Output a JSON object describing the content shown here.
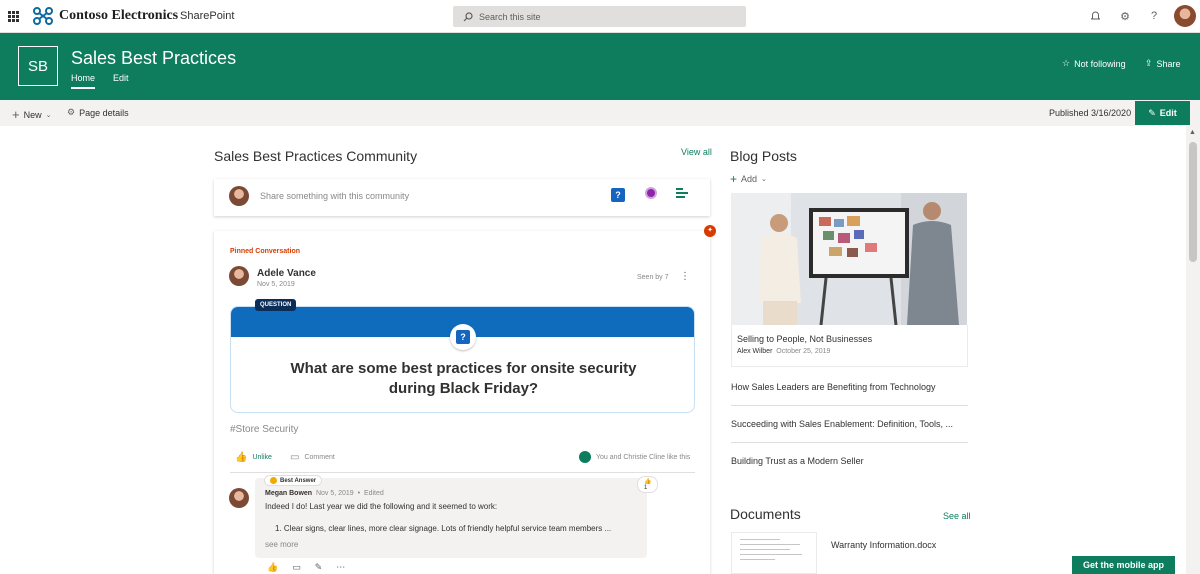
{
  "suite": {
    "brand_name": "Contoso Electronics",
    "app_name": "SharePoint",
    "search_placeholder": "Search this site"
  },
  "site": {
    "logo_text": "SB",
    "title": "Sales Best Practices",
    "nav": [
      "Home",
      "Edit"
    ],
    "follow_label": "Not following",
    "share_label": "Share",
    "accent_color": "#0d7d5e"
  },
  "command_bar": {
    "new_label": "New",
    "page_details_label": "Page details",
    "published": "Published 3/16/2020",
    "edit_label": "Edit"
  },
  "community": {
    "title": "Sales Best Practices Community",
    "view_all": "View all",
    "share_placeholder": "Share something with this community",
    "post": {
      "pinned_label": "Pinned Conversation",
      "author": "Adele Vance",
      "date": "Nov 5, 2019",
      "seen": "Seen by 7",
      "question_badge": "QUESTION",
      "question": "What are some best practices for onsite security during Black Friday?",
      "topic": "#Store Security",
      "unlike_label": "Unlike",
      "comment_label": "Comment",
      "likes_summary": "You and Christie Cline like this",
      "best_answer": {
        "badge": "Best Answer",
        "author": "Megan Bowen",
        "date": "Nov 5, 2019",
        "edited": "Edited",
        "like_count": "1",
        "line1": "Indeed I do! Last year we did the following and it seemed to work:",
        "line2": "1.   Clear signs, clear lines, more clear signage. Lots of friendly helpful service team members ...",
        "see_more": "see more"
      }
    }
  },
  "blog": {
    "title": "Blog Posts",
    "add_label": "Add",
    "featured": {
      "title": "Selling to People, Not Businesses",
      "author": "Alex Wilber",
      "date": "October 25, 2019"
    },
    "items": [
      "How Sales Leaders are Benefiting from Technology",
      "Succeeding with Sales Enablement: Definition, Tools, ...",
      "Building Trust as a Modern Seller"
    ]
  },
  "documents": {
    "title": "Documents",
    "see_all": "See all",
    "items": [
      "Warranty Information.docx"
    ]
  },
  "mobile_app_label": "Get the mobile app",
  "icons": [
    "waffle-icon",
    "contoso-logo-icon",
    "search-icon",
    "bell-icon",
    "settings-icon",
    "help-icon",
    "star-icon",
    "share-icon",
    "plus-icon",
    "chevron-down-icon",
    "gear-icon",
    "pencil-icon",
    "question-icon",
    "praise-icon",
    "poll-icon",
    "pin-icon",
    "like-icon",
    "comment-icon",
    "more-icon"
  ]
}
